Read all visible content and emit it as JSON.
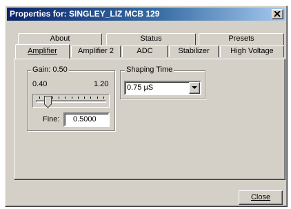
{
  "window": {
    "title": "Properties for: SINGLEY_LIZ MCB 129",
    "close_icon": "close-icon"
  },
  "tabs": {
    "back_row": [
      {
        "label": "About"
      },
      {
        "label": "Status"
      },
      {
        "label": "Presets"
      }
    ],
    "front_row": [
      {
        "label": "Amplifier",
        "active": true
      },
      {
        "label": "Amplifier 2"
      },
      {
        "label": "ADC"
      },
      {
        "label": "Stabilizer"
      },
      {
        "label": "High Voltage"
      }
    ]
  },
  "gain": {
    "legend": "Gain: 0.50",
    "min_label": "0.40",
    "max_label": "1.20",
    "slider_value": 0.5,
    "slider_min": 0.4,
    "slider_max": 1.2,
    "fine_label": "Fine:",
    "fine_value": "0.5000"
  },
  "shaping": {
    "legend": "Shaping Time",
    "selected": "0.75 µS"
  },
  "footer": {
    "close_label": "Close"
  },
  "colors": {
    "face": "#d4d0c8",
    "title_start": "#0a246a",
    "title_end": "#a6caf0"
  }
}
